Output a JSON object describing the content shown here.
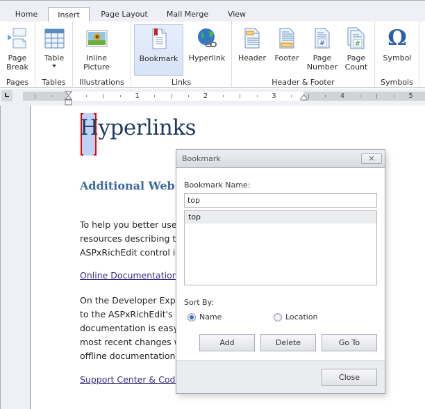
{
  "tabs": [
    {
      "label": "Home",
      "active": false
    },
    {
      "label": "Insert",
      "active": true
    },
    {
      "label": "Page Layout",
      "active": false
    },
    {
      "label": "Mail Merge",
      "active": false
    },
    {
      "label": "View",
      "active": false
    }
  ],
  "ribbon": {
    "groups": {
      "pages": {
        "label": "Pages",
        "buttons": {
          "page_break": {
            "line1": "Page",
            "line2": "Break",
            "icon": "page-break-icon"
          }
        }
      },
      "tables": {
        "label": "Tables",
        "buttons": {
          "table": {
            "line1": "Table",
            "icon": "table-icon",
            "has_dropdown": true
          }
        }
      },
      "illustrations": {
        "label": "Illustrations",
        "buttons": {
          "inline_picture": {
            "line1": "Inline",
            "line2": "Picture",
            "icon": "picture-icon"
          }
        }
      },
      "links": {
        "label": "Links",
        "buttons": {
          "bookmark": {
            "line1": "Bookmark",
            "icon": "bookmark-icon",
            "selected": true
          },
          "hyperlink": {
            "line1": "Hyperlink",
            "icon": "hyperlink-globe-icon"
          }
        }
      },
      "header_footer": {
        "label": "Header & Footer",
        "buttons": {
          "header": {
            "line1": "Header",
            "icon": "header-icon"
          },
          "footer": {
            "line1": "Footer",
            "icon": "footer-icon"
          },
          "page_number": {
            "line1": "Page",
            "line2": "Number",
            "icon": "page-number-icon"
          },
          "page_count": {
            "line1": "Page",
            "line2": "Count",
            "icon": "page-count-icon"
          }
        }
      },
      "symbols": {
        "label": "Symbols",
        "buttons": {
          "symbol": {
            "line1": "Symbol",
            "icon": "omega-icon",
            "glyph": "Ω"
          }
        }
      }
    }
  },
  "ruler": {
    "numbers": [
      "1",
      "2",
      "3",
      "4",
      "5"
    ]
  },
  "document": {
    "title": "Hyperlinks",
    "heading": "Additional Web",
    "para1": [
      "To help you better use",
      "resources describing th",
      "ASPxRichEdit control ir"
    ],
    "link1": "Online Documentation",
    "para2": [
      "On the Developer Expr",
      "to the ASPxRichEdit's c",
      "documentation is easy",
      "most recent changes w",
      "offline documentation"
    ],
    "link2": "Support Center & Code"
  },
  "dialog": {
    "title": "Bookmark",
    "close_glyph": "✕",
    "name_label": "Bookmark Name:",
    "name_value": "top",
    "list_items": [
      "top"
    ],
    "sort_label": "Sort By:",
    "sort_options": [
      {
        "label": "Name",
        "checked": true
      },
      {
        "label": "Location",
        "checked": false
      }
    ],
    "buttons": {
      "add": "Add",
      "delete": "Delete",
      "goto": "Go To",
      "close": "Close"
    }
  },
  "colors": {
    "accent": "#3c6a9f",
    "selection": "#bcd3f7",
    "selection_border": "#e00000",
    "link": "#3c2a82"
  }
}
